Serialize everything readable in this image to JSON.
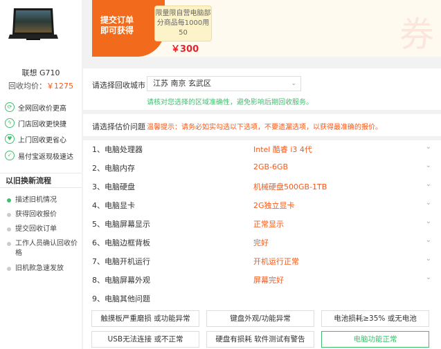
{
  "product": {
    "name": "联想 G710",
    "price_label": "回收均价：",
    "price_value": "￥1275"
  },
  "features": [
    {
      "icon": "refresh-icon",
      "label": "全网回收价更高"
    },
    {
      "icon": "lightning-icon",
      "label": "门店回收更快捷"
    },
    {
      "icon": "heart-icon",
      "label": "上门回收更省心"
    },
    {
      "icon": "check-icon",
      "label": "易付宝返现极速达"
    }
  ],
  "process": {
    "title": "以旧换新流程",
    "steps": [
      "描述旧机情况",
      "获得回收报价",
      "提交回收订单",
      "工作人员确认回收价格",
      "旧机款急速发放"
    ]
  },
  "banner": {
    "line1": "提交订单",
    "line2": "即可获得",
    "coupon_text": "限量限自营电脑部分商品每1000用50",
    "amount": "￥300",
    "deco": "券"
  },
  "city": {
    "label": "请选择回收城市",
    "value": "江苏 南京 玄武区",
    "note": "请核对您选择的区域准确性，避免影响后期回收服务。"
  },
  "estimate": {
    "label": "请选择估价问题",
    "tip": "温馨提示：请务必如实勾选以下选项，不要遗漏选项，以获得最准确的报价。"
  },
  "questions": [
    {
      "q": "1、电脑处理器",
      "a": "Intel 酷睿 i3 4代"
    },
    {
      "q": "2、电脑内存",
      "a": "2GB-6GB"
    },
    {
      "q": "3、电脑硬盘",
      "a": "机械硬盘500GB-1TB"
    },
    {
      "q": "4、电脑显卡",
      "a": "2G独立显卡"
    },
    {
      "q": "5、电脑屏幕显示",
      "a": "正常显示"
    },
    {
      "q": "6、电脑边框背板",
      "a": "完好"
    },
    {
      "q": "7、电脑开机运行",
      "a": "开机运行正常"
    },
    {
      "q": "8、电脑屏幕外观",
      "a": "屏幕完好"
    },
    {
      "q": "9、电脑其他问题",
      "a": ""
    }
  ],
  "other_options": [
    "触摸板严重磨损 或功能异常",
    "键盘外观/功能异常",
    "电池损耗≥35% 或无电池",
    "USB无法连接 或不正常",
    "硬盘有损耗 软件测试有警告",
    "电脑功能正常"
  ],
  "colors": {
    "accent_orange": "#f35a1b",
    "accent_green": "#3fbf6e",
    "banner_orange": "#f26b1d"
  }
}
